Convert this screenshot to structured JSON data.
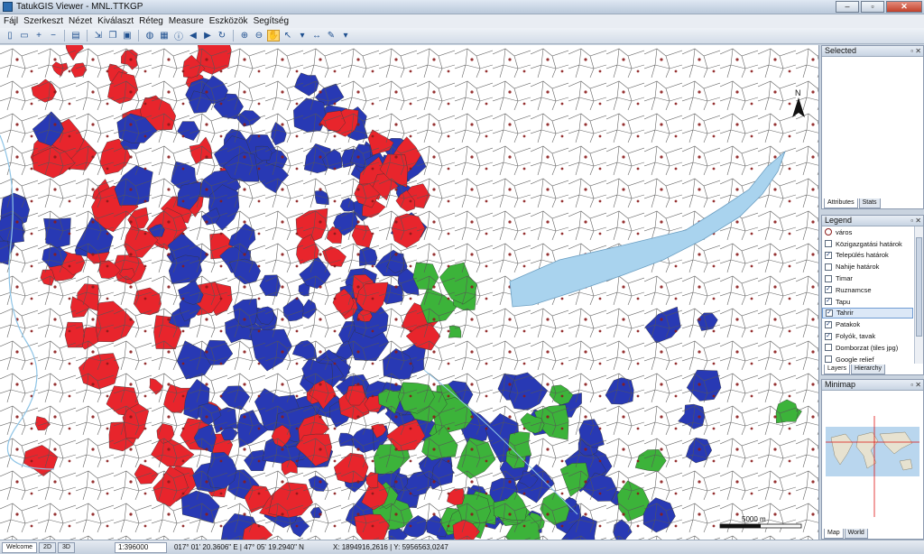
{
  "window": {
    "title": "TatukGIS Viewer - MNL.TTKGP"
  },
  "window_controls": {
    "minimize": "–",
    "maximize": "▫",
    "close": "✕"
  },
  "menu": [
    "Fájl",
    "Szerkeszt",
    "Nézet",
    "Kiválaszt",
    "Réteg",
    "Measure",
    "Eszközök",
    "Segítség"
  ],
  "map": {
    "north_label": "N",
    "scale_label": "5000 m"
  },
  "selected_panel": {
    "title": "Selected",
    "tabs": [
      "Attributes",
      "Stats"
    ]
  },
  "legend_panel": {
    "title": "Legend",
    "items": [
      {
        "label": "város",
        "checked": null
      },
      {
        "label": "Közigazgatási határok",
        "checked": false
      },
      {
        "label": "Település határok",
        "checked": true
      },
      {
        "label": "Nahije határok",
        "checked": false
      },
      {
        "label": "Timar",
        "checked": false
      },
      {
        "label": "Ruznamcse",
        "checked": true
      },
      {
        "label": "Tapu",
        "checked": true
      },
      {
        "label": "Tahrir",
        "checked": true,
        "selected": true
      },
      {
        "label": "Patakok",
        "checked": true
      },
      {
        "label": "Folyók, tavak",
        "checked": true
      },
      {
        "label": "Domborzat (tiles jpg)",
        "checked": false
      },
      {
        "label": "Google relief",
        "checked": false
      }
    ],
    "tabs": [
      "Layers",
      "Hierarchy"
    ]
  },
  "minimap_panel": {
    "title": "Minimap",
    "tabs": [
      "Map",
      "World"
    ]
  },
  "statusbar": {
    "view_tabs": [
      "Welcome",
      "2D",
      "3D"
    ],
    "scale": "1:396000",
    "geo_coords": "017° 01' 20.3606\" E | 47° 05' 19.2940\" N",
    "xy_coords": "X: 1894916,2616 | Y: 5956563,0247"
  },
  "colors": {
    "tahrir": "#e8252c",
    "tapu": "#2839b4",
    "ruznamcse": "#3cb33a",
    "water": "#a9d3ee",
    "border": "#555555",
    "settlement_dot": "#8a1b1b"
  }
}
